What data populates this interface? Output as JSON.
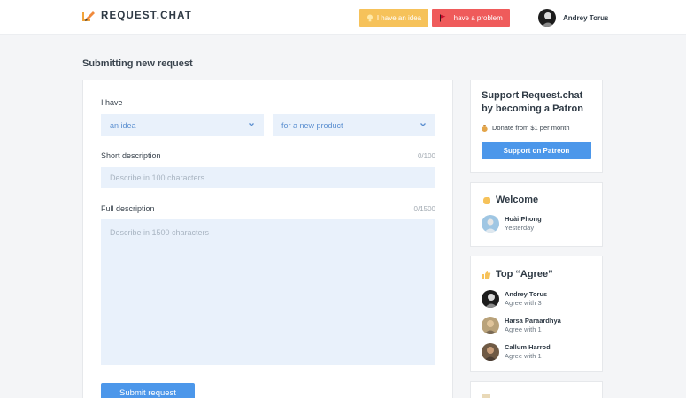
{
  "header": {
    "logo_text": "REQUEST.CHAT",
    "idea_button": "I have an idea",
    "problem_button": "I have a problem",
    "user_name": "Andrey Torus"
  },
  "page": {
    "title": "Submitting new request"
  },
  "form": {
    "type_label": "I have",
    "type_value": "an idea",
    "target_value": "for a new product",
    "short_label": "Short description",
    "short_counter": "0/100",
    "short_placeholder": "Describe in 100 characters",
    "full_label": "Full description",
    "full_counter": "0/1500",
    "full_placeholder": "Describe in 1500 characters",
    "submit_label": "Submit request"
  },
  "support": {
    "title": "Support Request.chat by becoming a Patron",
    "donate_text": "Donate from $1 per month",
    "button_label": "Support on Patreon"
  },
  "welcome": {
    "title": "Welcome",
    "user": {
      "name": "Hoài Phong",
      "sub": "Yesterday"
    }
  },
  "top_agree": {
    "title": "Top “Agree”",
    "users": [
      {
        "name": "Andrey Torus",
        "sub": "Agree with 3"
      },
      {
        "name": "Harsa Paraardhya",
        "sub": "Agree with 1"
      },
      {
        "name": "Callum Harrod",
        "sub": "Agree with 1"
      }
    ]
  },
  "colors": {
    "accent": "#4c97ea",
    "idea": "#f6c25a",
    "problem": "#ef5b5b",
    "field_bg": "#e9f1fb"
  }
}
